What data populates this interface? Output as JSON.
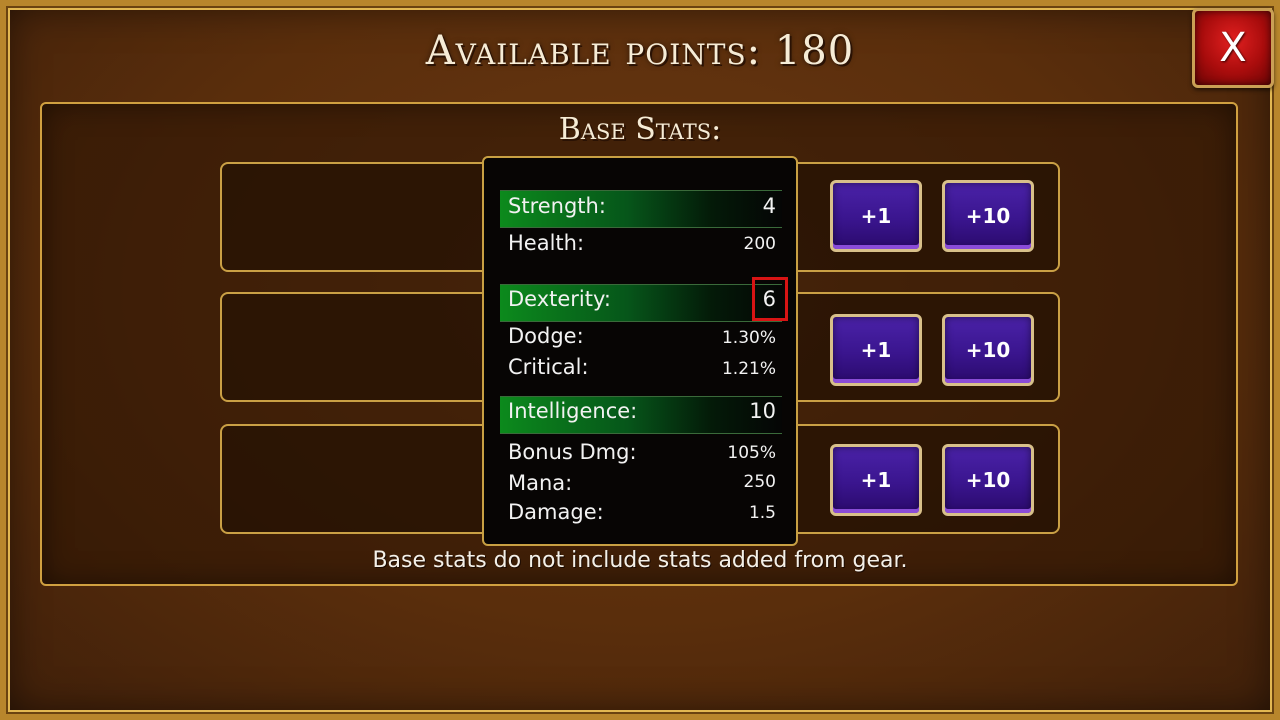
{
  "header": {
    "title": "Available points: 180",
    "close_label": "X"
  },
  "panel": {
    "title": "Base Stats:",
    "note": "Base stats do not include stats added from gear."
  },
  "buttons": {
    "plus1_label": "+1",
    "plus10_label": "+10"
  },
  "tooltip": {
    "strength": {
      "label": "Strength:",
      "value": "4"
    },
    "health": {
      "label": "Health:",
      "value": "200"
    },
    "dexterity": {
      "label": "Dexterity:",
      "value": "6"
    },
    "dodge": {
      "label": "Dodge:",
      "value": "1.30%"
    },
    "critical": {
      "label": "Critical:",
      "value": "1.21%"
    },
    "intelligence": {
      "label": "Intelligence:",
      "value": "10"
    },
    "bonus_dmg": {
      "label": "Bonus Dmg:",
      "value": "105%"
    },
    "mana": {
      "label": "Mana:",
      "value": "250"
    },
    "damage": {
      "label": "Damage:",
      "value": "1.5"
    }
  },
  "colors": {
    "accent_gold": "#caa045",
    "button_purple": "#3a158e",
    "stat_green": "#0c8a1c",
    "close_red": "#a80c0c",
    "highlight_red": "#d81414"
  }
}
